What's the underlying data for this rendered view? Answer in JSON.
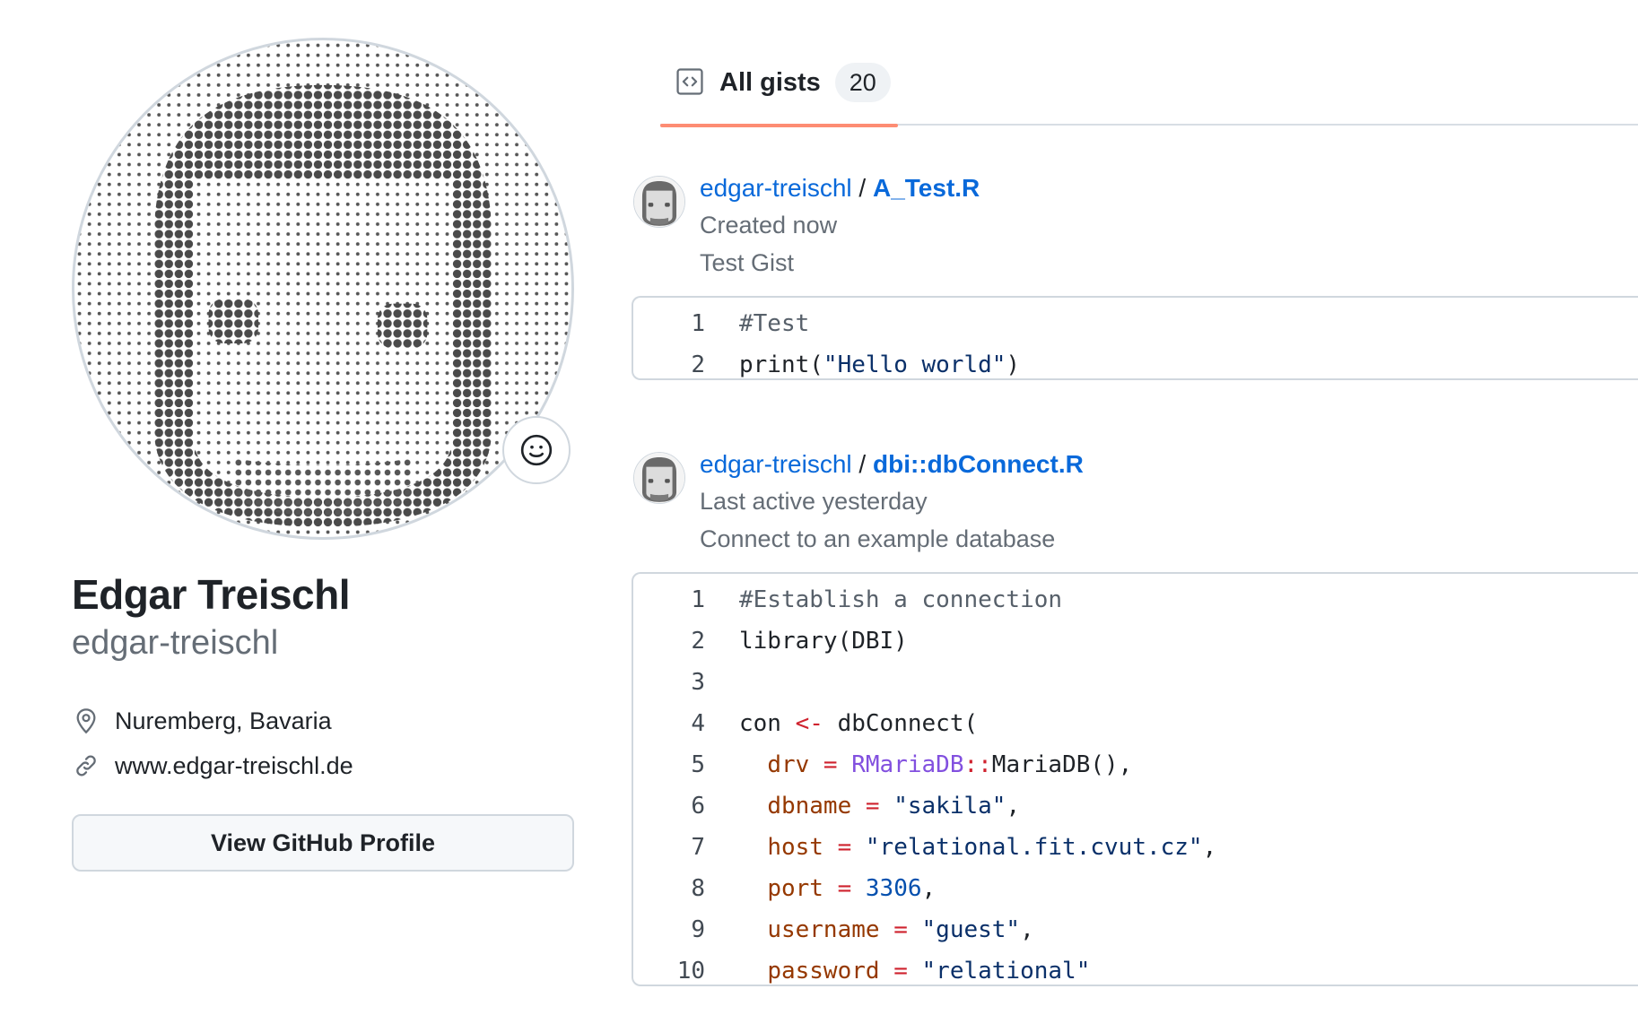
{
  "profile": {
    "name": "Edgar Treischl",
    "login": "edgar-treischl",
    "location": "Nuremberg, Bavaria",
    "website": "www.edgar-treischl.de",
    "view_profile_label": "View GitHub Profile",
    "avatar_icon": "pixel-face-avatar",
    "emoji_icon": "smiley-icon"
  },
  "tabs": {
    "all_gists_label": "All gists",
    "all_gists_count": "20",
    "active_color": "#fd8c73"
  },
  "gists": [
    {
      "owner": "edgar-treischl",
      "separator": "/",
      "filename": "A_Test.R",
      "time": "Created now",
      "description": "Test Gist",
      "lines": [
        {
          "n": "1",
          "parts": [
            {
              "t": "#Test",
              "c": "tk-comment"
            }
          ]
        },
        {
          "n": "2",
          "parts": [
            {
              "t": "print(",
              "c": ""
            },
            {
              "t": "\"Hello world\"",
              "c": "tk-str"
            },
            {
              "t": ")",
              "c": ""
            }
          ]
        }
      ]
    },
    {
      "owner": "edgar-treischl",
      "separator": "/",
      "filename": "dbi::dbConnect.R",
      "time": "Last active yesterday",
      "description": "Connect to an example database",
      "lines": [
        {
          "n": "1",
          "parts": [
            {
              "t": "#Establish a connection",
              "c": "tk-comment"
            }
          ]
        },
        {
          "n": "2",
          "parts": [
            {
              "t": "library(DBI)",
              "c": ""
            }
          ]
        },
        {
          "n": "3",
          "parts": [
            {
              "t": "",
              "c": ""
            }
          ]
        },
        {
          "n": "4",
          "parts": [
            {
              "t": "con ",
              "c": ""
            },
            {
              "t": "<-",
              "c": "tk-op"
            },
            {
              "t": " dbConnect(",
              "c": ""
            }
          ]
        },
        {
          "n": "5",
          "parts": [
            {
              "t": "  ",
              "c": ""
            },
            {
              "t": "drv",
              "c": "tk-arg"
            },
            {
              "t": " = ",
              "c": "tk-op"
            },
            {
              "t": "RMariaDB",
              "c": "tk-ns"
            },
            {
              "t": "::",
              "c": "tk-op"
            },
            {
              "t": "MariaDB(),",
              "c": ""
            }
          ]
        },
        {
          "n": "6",
          "parts": [
            {
              "t": "  ",
              "c": ""
            },
            {
              "t": "dbname",
              "c": "tk-arg"
            },
            {
              "t": " = ",
              "c": "tk-op"
            },
            {
              "t": "\"sakila\"",
              "c": "tk-str"
            },
            {
              "t": ",",
              "c": ""
            }
          ]
        },
        {
          "n": "7",
          "parts": [
            {
              "t": "  ",
              "c": ""
            },
            {
              "t": "host",
              "c": "tk-arg"
            },
            {
              "t": " = ",
              "c": "tk-op"
            },
            {
              "t": "\"relational.fit.cvut.cz\"",
              "c": "tk-str"
            },
            {
              "t": ",",
              "c": ""
            }
          ]
        },
        {
          "n": "8",
          "parts": [
            {
              "t": "  ",
              "c": ""
            },
            {
              "t": "port",
              "c": "tk-arg"
            },
            {
              "t": " = ",
              "c": "tk-op"
            },
            {
              "t": "3306",
              "c": "tk-num"
            },
            {
              "t": ",",
              "c": ""
            }
          ]
        },
        {
          "n": "9",
          "parts": [
            {
              "t": "  ",
              "c": ""
            },
            {
              "t": "username",
              "c": "tk-arg"
            },
            {
              "t": " = ",
              "c": "tk-op"
            },
            {
              "t": "\"guest\"",
              "c": "tk-str"
            },
            {
              "t": ",",
              "c": ""
            }
          ]
        },
        {
          "n": "10",
          "parts": [
            {
              "t": "  ",
              "c": ""
            },
            {
              "t": "password",
              "c": "tk-arg"
            },
            {
              "t": " = ",
              "c": "tk-op"
            },
            {
              "t": "\"relational\"",
              "c": "tk-str"
            }
          ]
        }
      ]
    }
  ]
}
